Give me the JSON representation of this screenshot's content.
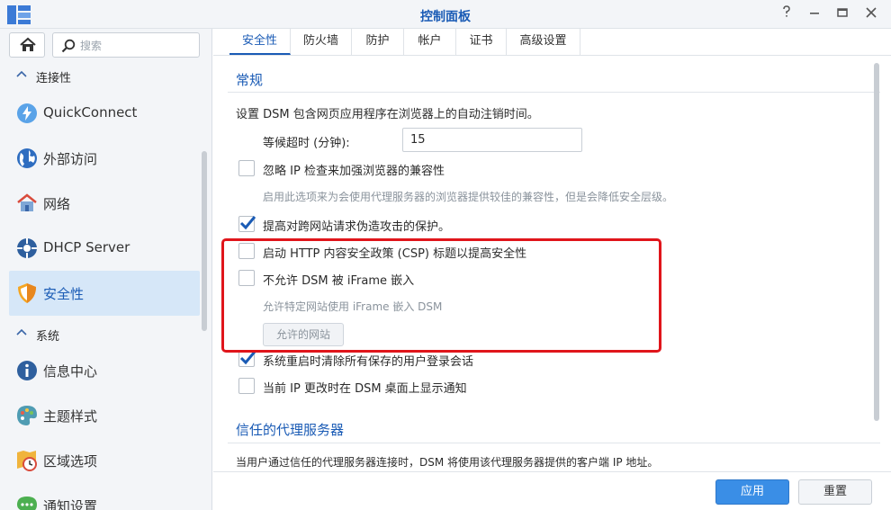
{
  "window": {
    "title": "控制面板"
  },
  "sidebar": {
    "search_placeholder": "搜索",
    "sections": [
      {
        "label": "连接性"
      },
      {
        "label": "系统"
      }
    ],
    "items": [
      {
        "label": "QuickConnect",
        "icon": "quickconnect-icon"
      },
      {
        "label": "外部访问",
        "icon": "globe-icon"
      },
      {
        "label": "网络",
        "icon": "house-network-icon"
      },
      {
        "label": "DHCP Server",
        "icon": "dhcp-icon"
      },
      {
        "label": "安全性",
        "icon": "shield-icon",
        "active": true
      },
      {
        "label": "信息中心",
        "icon": "info-icon"
      },
      {
        "label": "主题样式",
        "icon": "palette-icon"
      },
      {
        "label": "区域选项",
        "icon": "region-clock-icon"
      },
      {
        "label": "通知设置",
        "icon": "chat-icon"
      }
    ]
  },
  "tabs": [
    {
      "label": "安全性",
      "active": true
    },
    {
      "label": "防火墙"
    },
    {
      "label": "防护"
    },
    {
      "label": "帐户"
    },
    {
      "label": "证书"
    },
    {
      "label": "高级设置"
    }
  ],
  "general": {
    "title": "常规",
    "description": "设置 DSM 包含网页应用程序在浏览器上的自动注销时间。",
    "timeout_label": "等候超时 (分钟):",
    "timeout_value": "15",
    "options": [
      {
        "label": "忽略 IP 检查来加强浏览器的兼容性",
        "checked": false
      },
      {
        "label": "提高对跨网站请求伪造攻击的保护。",
        "checked": true
      },
      {
        "label": "启动 HTTP 内容安全政策 (CSP) 标题以提高安全性",
        "checked": false
      },
      {
        "label": "不允许 DSM 被 iFrame 嵌入",
        "checked": false
      },
      {
        "label": "系统重启时清除所有保存的用户登录会话",
        "checked": true
      },
      {
        "label": "当前 IP 更改时在 DSM 桌面上显示通知",
        "checked": false
      }
    ],
    "ip_hint": "启用此选项来为会使用代理服务器的浏览器提供较佳的兼容性，但是会降低安全层级。",
    "iframe_hint": "允许特定网站使用 iFrame 嵌入 DSM",
    "allowed_sites_button": "允许的网站"
  },
  "proxy": {
    "title": "信任的代理服务器",
    "description": "当用户通过信任的代理服务器连接时，DSM 将使用该代理服务器提供的客户端 IP 地址。"
  },
  "footer": {
    "apply_label": "应用",
    "reset_label": "重置"
  },
  "colors": {
    "accent": "#1a5bb5",
    "primary_button": "#3a8ee6",
    "highlight_box": "#e0151b",
    "active_nav": "#d6e7f8"
  }
}
